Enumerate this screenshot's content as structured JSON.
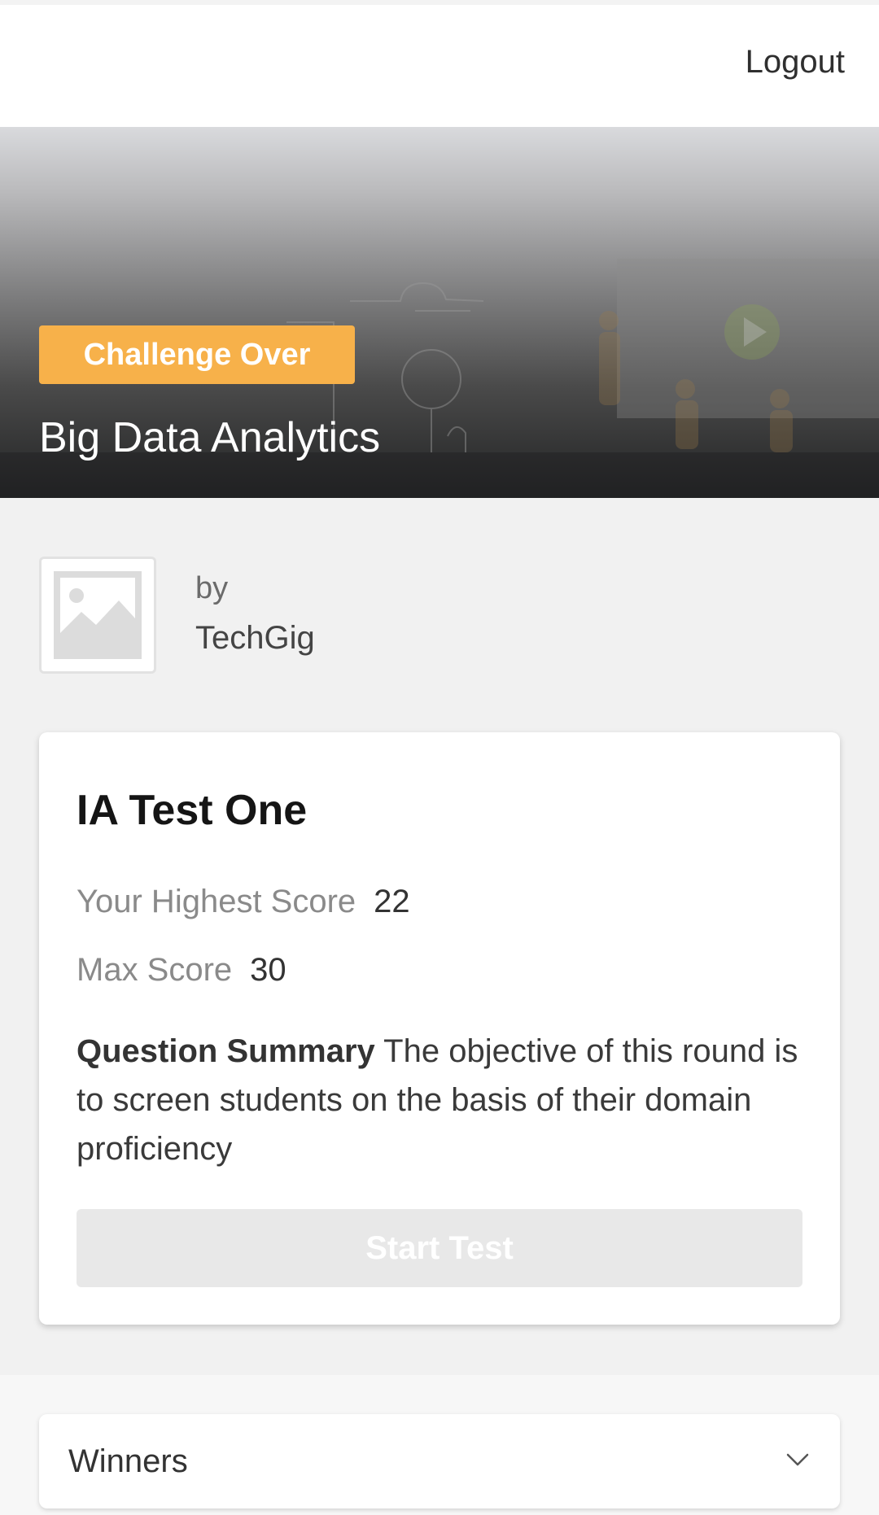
{
  "header": {
    "logout_label": "Logout"
  },
  "hero": {
    "status_badge": "Challenge Over",
    "title": "Big Data Analytics"
  },
  "organizer": {
    "by_label": "by",
    "name": "TechGig",
    "logo_icon": "image-placeholder-icon"
  },
  "test_card": {
    "title": "IA Test One",
    "highest_score_label": "Your Highest Score",
    "highest_score_value": "22",
    "max_score_label": "Max Score",
    "max_score_value": "30",
    "summary_label": "Question Summary",
    "summary_text": "The objective of this round is to screen students on the basis of their domain proficiency",
    "start_button_label": "Start Test"
  },
  "winners": {
    "label": "Winners",
    "toggle_icon": "chevron-down-icon"
  },
  "colors": {
    "badge": "#f7b14a",
    "page_bg": "#f1f1f1",
    "button_disabled": "#e8e8e8"
  }
}
